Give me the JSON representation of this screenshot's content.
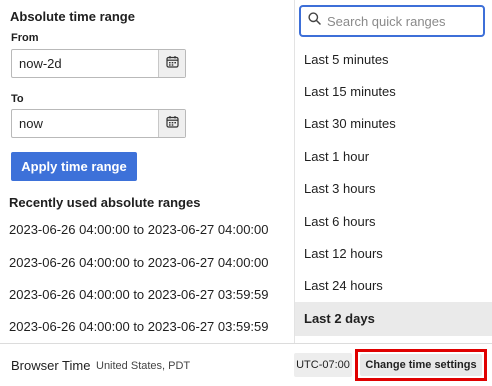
{
  "absolute": {
    "title": "Absolute time range",
    "from_label": "From",
    "from_value": "now-2d",
    "to_label": "To",
    "to_value": "now",
    "apply_label": "Apply time range"
  },
  "recent": {
    "title": "Recently used absolute ranges",
    "items": [
      "2023-06-26 04:00:00 to 2023-06-27 04:00:00",
      "2023-06-26 04:00:00 to 2023-06-27 04:00:00",
      "2023-06-26 04:00:00 to 2023-06-27 03:59:59",
      "2023-06-26 04:00:00 to 2023-06-27 03:59:59"
    ]
  },
  "quick": {
    "search_placeholder": "Search quick ranges",
    "items": [
      "Last 5 minutes",
      "Last 15 minutes",
      "Last 30 minutes",
      "Last 1 hour",
      "Last 3 hours",
      "Last 6 hours",
      "Last 12 hours",
      "Last 24 hours",
      "Last 2 days"
    ],
    "selected": "Last 2 days"
  },
  "footer": {
    "tz_name": "Browser Time",
    "tz_location": "United States, PDT",
    "tz_offset": "UTC-07:00",
    "change_label": "Change time settings"
  },
  "colors": {
    "primary": "#3d71d9",
    "highlight_border": "#e00000",
    "selected_bg": "#eaeaea"
  }
}
